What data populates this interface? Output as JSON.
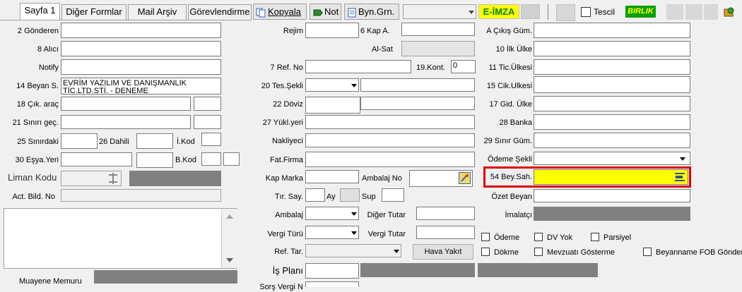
{
  "tabs": [
    "Sayfa 1",
    "Diğer Formlar",
    "Mail Arşiv",
    "Görevlendirme"
  ],
  "toolbar": {
    "copy": "Kopyala",
    "note": "Not",
    "byn": "Byn.Grn.",
    "eimza": "E-İMZA",
    "tescil": "Tescil",
    "birlik": "BIRLIK"
  },
  "left": {
    "gonderen": "2 Gönderen",
    "alici": "8 Alıcı",
    "notify": "Notify",
    "beyan": "14 Beyan S.",
    "beyan_value_1": "EVRİM YAZILIM VE DANIŞMANLIK",
    "beyan_value_2": "TİC.LTD.STİ. - DENEME",
    "cik_arac": "18 Çık. araç",
    "sinir_gec": "21 Sınırı geç.",
    "sinirdaki": "25 Sınırdaki",
    "dahili": "26 Dahili",
    "ikod": "İ.Kod",
    "esya_yeri": "30 Eşya.Yeri",
    "bkod": "B.Kod",
    "liman": "Liman Kodu",
    "act_bild": "Act. Bild. No",
    "muayene": "Muayene Memuru"
  },
  "middle": {
    "rejim": "Rejim",
    "kap_a": "6 Kap A.",
    "al_sat": "Al-Sat",
    "ref_no": "7 Ref. No",
    "kont": "19.Kont.",
    "kont_value": "0",
    "tes_sekli": "20 Tes.Şekli",
    "doviz": "22 Döviz",
    "yukl_yeri": "27 Yükl.yeri",
    "nakliyeci": "Nakliyeci",
    "fat_firma": "Fat.Firma",
    "kap_marka": "Kap Marka",
    "ambalaj_no": "Ambalaj No",
    "tir_say": "Tır. Say.",
    "ay": "Ay",
    "sup": "Sup",
    "ambalaj": "Ambalaj",
    "diger_tutar": "Diğer Tutar",
    "vergi_turu": "Vergi Türü",
    "vergi_tutar": "Vergi Tutar",
    "ref_tar": "Ref. Tar.",
    "hava_yakit": "Hava Yakıt",
    "is_plani": "İş Planı",
    "extra": "Sorş Vergi N"
  },
  "right": {
    "a_cikis": "A Çıkış Güm.",
    "ilk_ulke": "10 İlk Ülke",
    "tic_ulkesi": "11 Tic.Ülkesi",
    "cik_ulkesi": "15 Cik.Ulkesi",
    "gid_ulke": "17 Gid. Ülke",
    "banka": "28 Banka",
    "sinir_gum": "29 Sınır Güm.",
    "odeme_sekli": "Ödeme Şekli",
    "bey_sah": "54 Bey.Sah.",
    "ozet_beyan": "Özet Beyan",
    "imalatci": "İmalatçı",
    "odeme": "Ödeme",
    "dv_yok": "DV Yok",
    "parsiyel": "Parsiyel",
    "dokme": "Dökme",
    "mevzuati": "Mevzuatı Gösterme",
    "fob": "Beyanname FOB Gönder"
  },
  "colors": {
    "highlight_border": "#e00000",
    "yellow": "#ffff00",
    "eimza_bg": "#ffff00",
    "eimza_text": "#008000",
    "birlik_bg": "#00a000",
    "birlik_text": "#ffff00"
  }
}
